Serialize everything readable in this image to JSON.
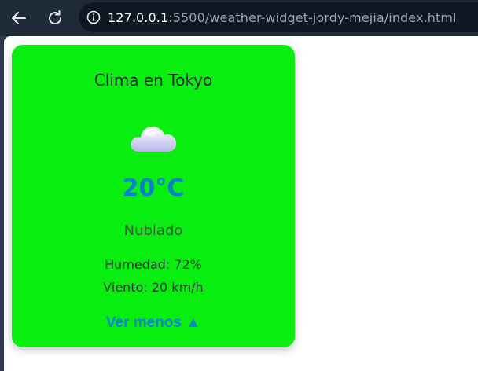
{
  "browser": {
    "url_host": "127.0.0.1",
    "url_rest": ":5500/weather-widget-jordy-mejia/index.html"
  },
  "widget": {
    "title": "Clima en Tokyo",
    "icon": "cloud-icon",
    "temperature": "20°C",
    "condition": "Nublado",
    "humidity": "Humedad: 72%",
    "wind": "Viento: 20 km/h",
    "toggle_label": "Ver menos ▲",
    "colors": {
      "background": "#08ee0f",
      "accent": "#0a7fd6"
    }
  }
}
